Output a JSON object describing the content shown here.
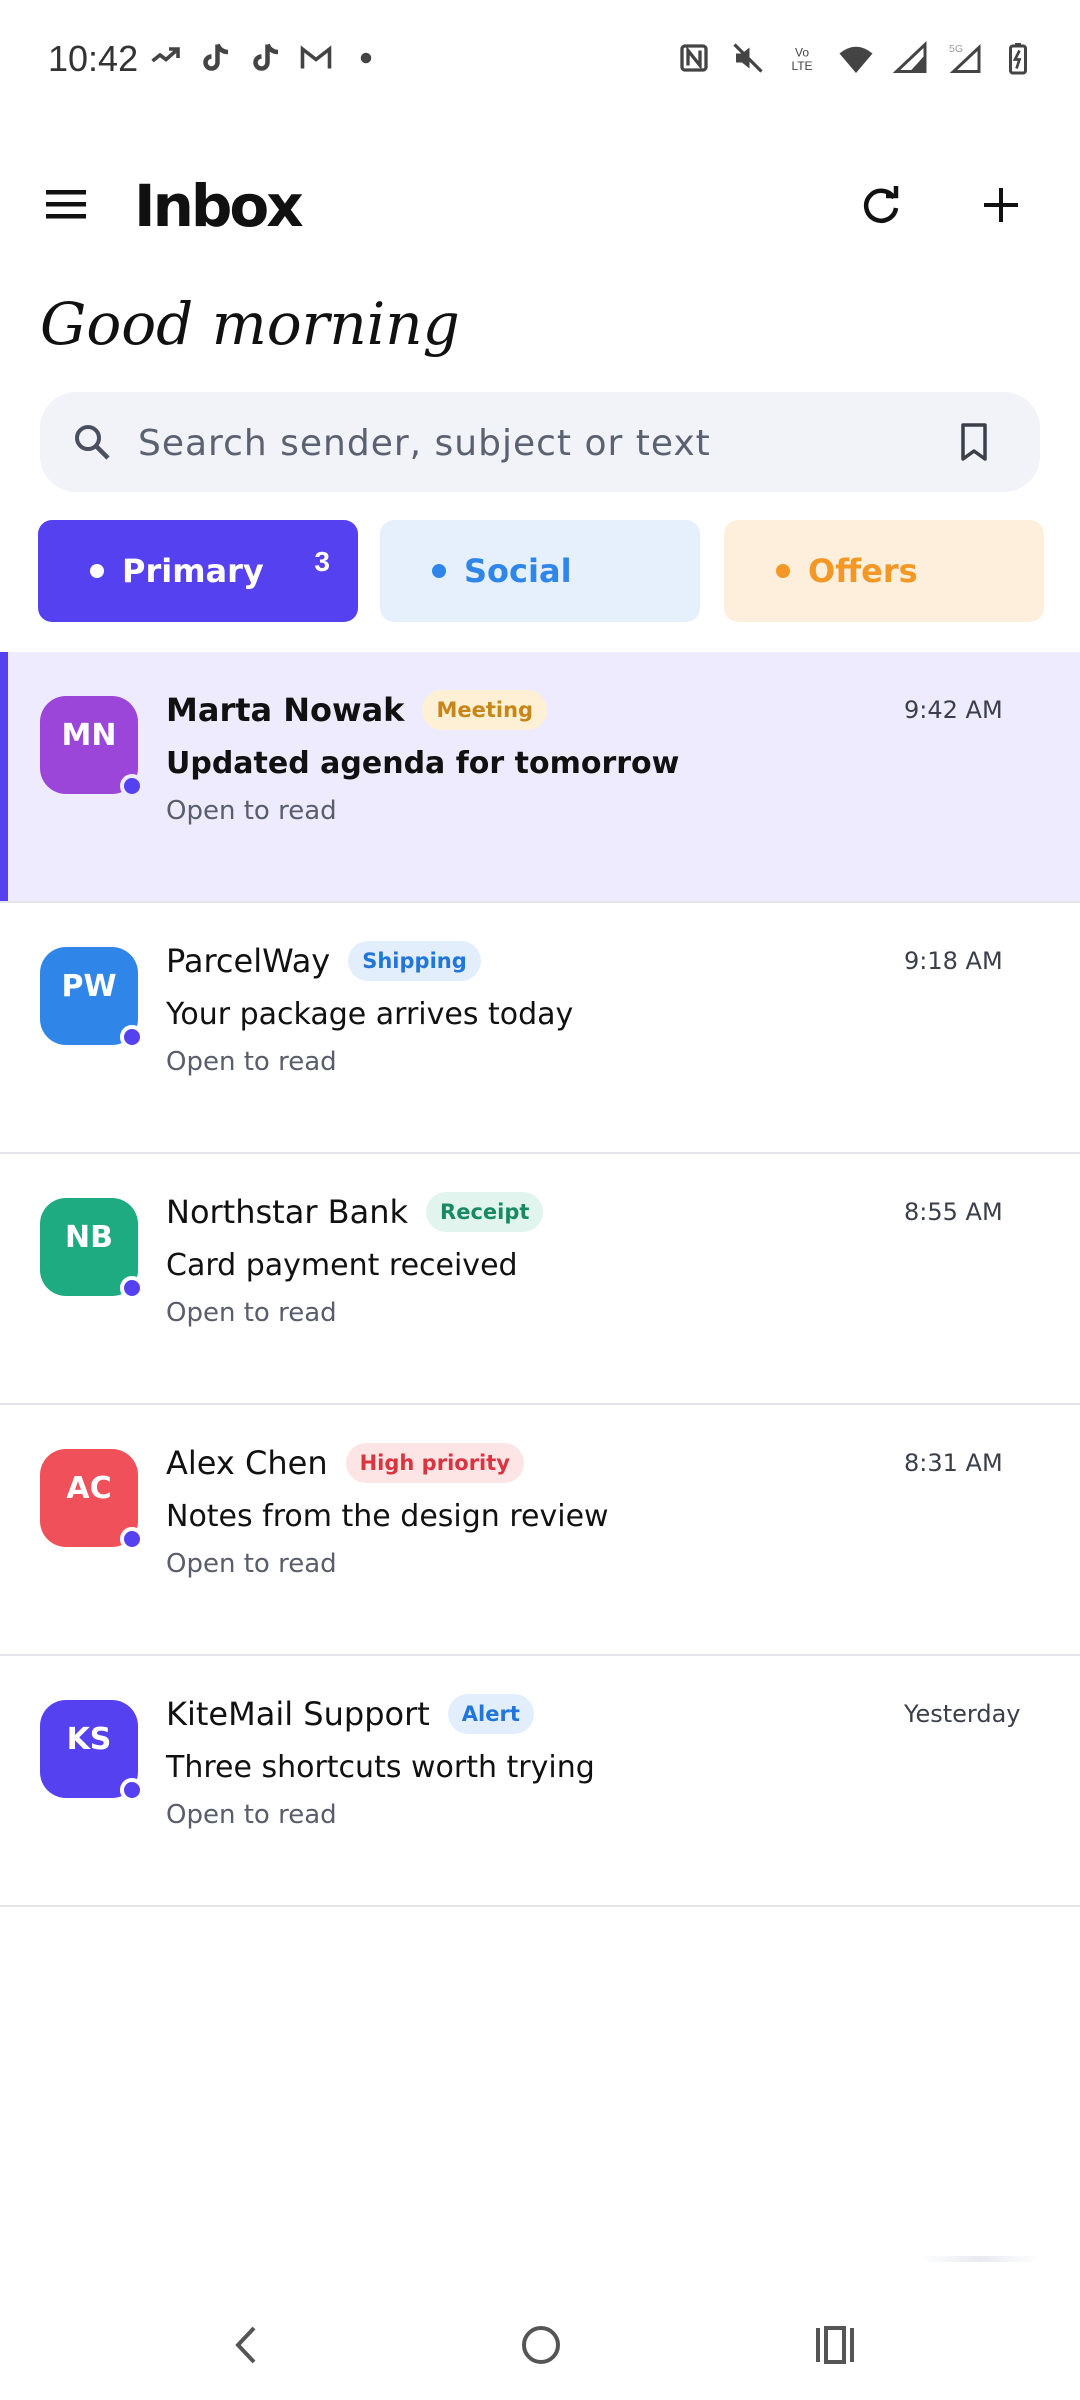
{
  "status_bar": {
    "time": "10:42",
    "left_icons": [
      "missed-call-icon",
      "tiktok-icon",
      "tiktok-icon",
      "gmail-icon",
      "dot-icon"
    ],
    "right_icons": [
      "nfc-icon",
      "mute-icon",
      "volte-icon",
      "wifi-icon",
      "signal-icon",
      "signal-5g-icon",
      "battery-charging-icon"
    ]
  },
  "app_bar": {
    "title": "Inbox",
    "menu_icon": "menu-icon",
    "refresh_icon": "refresh-icon",
    "add_icon": "add-icon"
  },
  "greeting": "Good morning",
  "search": {
    "placeholder": "Search sender, subject or text",
    "icon": "search-icon",
    "bookmark_icon": "bookmark-icon"
  },
  "tabs": [
    {
      "label": "Primary",
      "count": "3",
      "color": "#5641f0",
      "selected": true
    },
    {
      "label": "Social",
      "color": "#2f86e8",
      "selected": false
    },
    {
      "label": "Offers",
      "color": "#f39826",
      "selected": false
    }
  ],
  "emails": [
    {
      "initials": "MN",
      "avatar_color": "#9b45d9",
      "sender": "Marta Nowak",
      "tag": "Meeting",
      "tag_color": "#c7861a",
      "tag_bg": "#fdf0d4",
      "time": "9:42 AM",
      "subject": "Updated agenda for tomorrow",
      "preview": "Open to read",
      "unread": true
    },
    {
      "initials": "PW",
      "avatar_color": "#2f86e8",
      "sender": "ParcelWay",
      "tag": "Shipping",
      "tag_color": "#2176d9",
      "tag_bg": "#e3eefc",
      "time": "9:18 AM",
      "subject": "Your package arrives today",
      "preview": "Open to read",
      "unread": false
    },
    {
      "initials": "NB",
      "avatar_color": "#1fab82",
      "sender": "Northstar Bank",
      "tag": "Receipt",
      "tag_color": "#178a63",
      "tag_bg": "#e1f5ee",
      "time": "8:55 AM",
      "subject": "Card payment received",
      "preview": "Open to read",
      "unread": false
    },
    {
      "initials": "AC",
      "avatar_color": "#f0505a",
      "sender": "Alex Chen",
      "tag": "High priority",
      "tag_color": "#d93440",
      "tag_bg": "#fde5e6",
      "time": "8:31 AM",
      "subject": "Notes from the design review",
      "preview": "Open to read",
      "unread": false
    },
    {
      "initials": "KS",
      "avatar_color": "#5641f0",
      "sender": "KiteMail Support",
      "tag": "Alert",
      "tag_color": "#2176d9",
      "tag_bg": "#e3eefc",
      "time": "Yesterday",
      "subject": "Three shortcuts worth trying",
      "preview": "Open to read",
      "unread": false
    }
  ],
  "nav_bar": {
    "icons": [
      "back-icon",
      "home-icon",
      "recent-apps-icon"
    ]
  }
}
